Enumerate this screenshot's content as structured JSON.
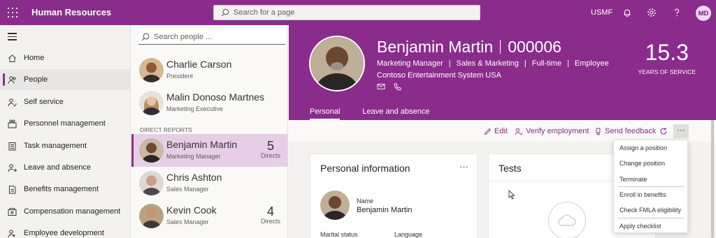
{
  "topbar": {
    "app_title": "Human Resources",
    "search_placeholder": "Search for a page",
    "company": "USMF",
    "user_initials": "MD",
    "colors": {
      "brand": "#8a2c8b"
    }
  },
  "nav": {
    "items": [
      {
        "label": "Home",
        "icon": "home-icon"
      },
      {
        "label": "People",
        "icon": "people-icon",
        "active": true
      },
      {
        "label": "Self service",
        "icon": "self-service-icon"
      },
      {
        "label": "Personnel management",
        "icon": "personnel-icon"
      },
      {
        "label": "Task management",
        "icon": "task-icon"
      },
      {
        "label": "Leave and absence",
        "icon": "leave-icon"
      },
      {
        "label": "Benefits management",
        "icon": "benefits-icon"
      },
      {
        "label": "Compensation management",
        "icon": "compensation-icon"
      },
      {
        "label": "Employee development",
        "icon": "development-icon"
      }
    ]
  },
  "people": {
    "search_placeholder": "Search people ...",
    "section_label": "DIRECT REPORTS",
    "managers": [
      {
        "name": "Charlie Carson",
        "title": "President"
      },
      {
        "name": "Malin Donoso Martnes",
        "title": "Marketing Executive"
      }
    ],
    "reports": [
      {
        "name": "Benjamin Martin",
        "title": "Marketing Manager",
        "directs": "5",
        "directs_label": "Directs",
        "selected": true
      },
      {
        "name": "Chris Ashton",
        "title": "Sales Manager"
      },
      {
        "name": "Kevin Cook",
        "title": "Sales Manager",
        "directs": "4",
        "directs_label": "Directs"
      }
    ]
  },
  "employee": {
    "name": "Benjamin Martin",
    "id": "000006",
    "position": "Marketing Manager",
    "department": "Sales & Marketing",
    "schedule": "Full-time",
    "type": "Employee",
    "company": "Contoso Entertainment System USA",
    "years_of_service": "15.3",
    "years_label": "YEARS OF SERVICE",
    "tabs": [
      "Personal",
      "Leave and absence"
    ]
  },
  "actions": {
    "edit": "Edit",
    "verify": "Verify employment",
    "feedback": "Send feedback",
    "more": "···"
  },
  "cards": {
    "personal": {
      "title": "Personal information",
      "more": "···",
      "name_label": "Name",
      "name_value": "Benjamin Martin",
      "marital_label": "Marital status",
      "language_label": "Language"
    },
    "tests": {
      "title": "Tests"
    }
  },
  "menu": {
    "items": [
      "Assign a position",
      "Change position",
      "Terminate",
      "Enroll in benefits",
      "Check FMLA eligibility",
      "Apply checklist"
    ]
  }
}
